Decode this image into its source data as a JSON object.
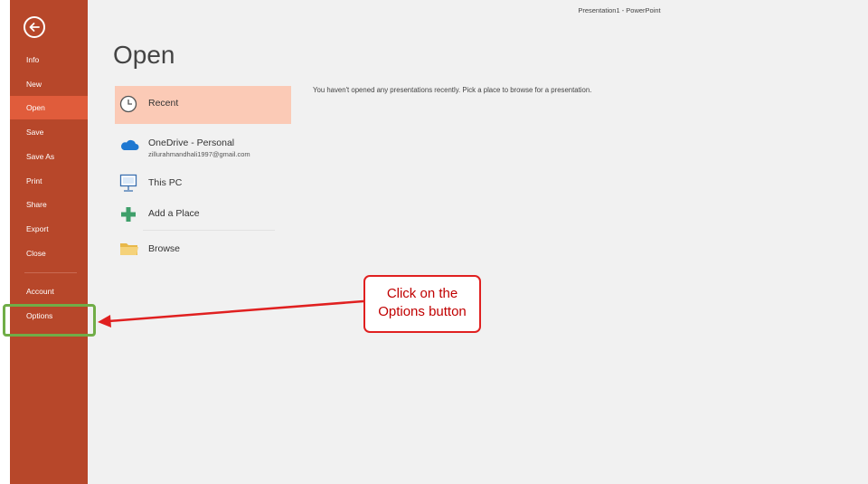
{
  "window": {
    "title": "Presentation1 - PowerPoint"
  },
  "sidebar": {
    "back_icon": "back-arrow-icon",
    "items": [
      {
        "label": "Info"
      },
      {
        "label": "New"
      },
      {
        "label": "Open",
        "active": true
      },
      {
        "label": "Save"
      },
      {
        "label": "Save As"
      },
      {
        "label": "Print"
      },
      {
        "label": "Share"
      },
      {
        "label": "Export"
      },
      {
        "label": "Close"
      },
      {
        "label": "Account"
      },
      {
        "label": "Options"
      }
    ]
  },
  "main": {
    "title": "Open",
    "places": [
      {
        "label": "Recent",
        "icon": "clock-icon"
      },
      {
        "label": "OneDrive - Personal",
        "sublabel": "zillurahmandhali1997@gmail.com",
        "icon": "cloud-icon"
      },
      {
        "label": "This PC",
        "icon": "computer-icon"
      },
      {
        "label": "Add a Place",
        "icon": "plus-icon"
      },
      {
        "label": "Browse",
        "icon": "folder-icon"
      }
    ],
    "empty_message": "You haven't opened any presentations recently. Pick a place to browse for a presentation."
  },
  "annotation": {
    "callout_line1": "Click on the",
    "callout_line2": "Options button"
  },
  "colors": {
    "sidebar": "#b7472a",
    "sidebar_active": "#e05c3b",
    "recent_highlight": "#fbcab6",
    "callout_red": "#e02020",
    "highlight_green": "#70ad47"
  }
}
